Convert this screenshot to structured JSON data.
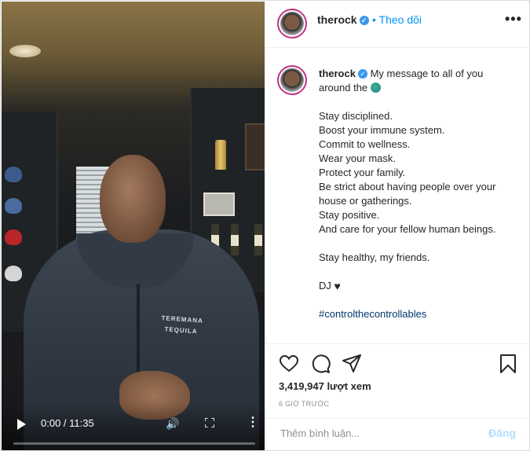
{
  "header": {
    "username": "therock",
    "follow_label": "• Theo dõi",
    "more_icon": "more-icon"
  },
  "caption": {
    "username": "therock",
    "intro": "My message to all of you around the",
    "lines": [
      "Stay disciplined.",
      "Boost your immune system.",
      "Commit to wellness.",
      "Wear your mask.",
      "Protect your family.",
      "Be strict about having people over your house or gatherings.",
      "Stay positive.",
      "And care for your fellow human beings."
    ],
    "closing": "Stay healthy, my friends.",
    "signature": "DJ",
    "hashtag": "#controlthecontrollables"
  },
  "video": {
    "time": "0:00 / 11:35",
    "logo_line1": "TEREMANA",
    "logo_line2": "TEQUILA"
  },
  "actions": {
    "views": "3,419,947 lượt xem",
    "posted_ago": "6 GIỜ TRƯỚC"
  },
  "comment": {
    "placeholder": "Thêm bình luận...",
    "post_label": "Đăng"
  },
  "colors": {
    "link_blue": "#0095f6",
    "verified_blue": "#3897f0",
    "post_disabled": "#b2dffc"
  }
}
